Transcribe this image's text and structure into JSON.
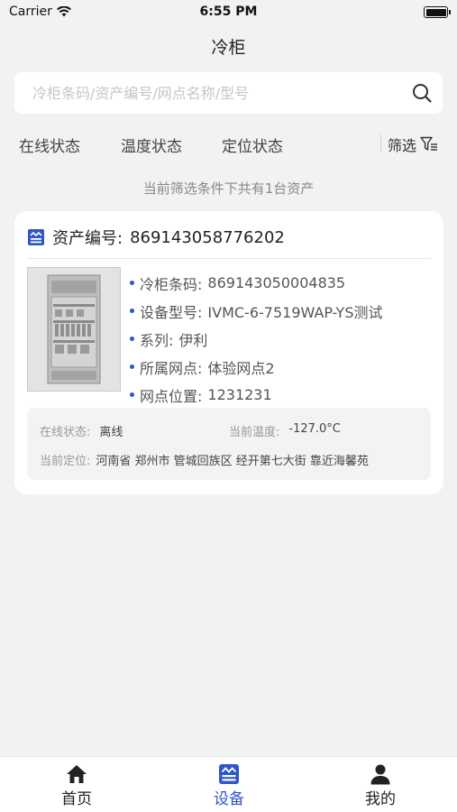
{
  "status_bar": {
    "carrier": "Carrier",
    "time": "6:55 PM"
  },
  "nav": {
    "title": "冷柜"
  },
  "search": {
    "placeholder": "冷柜条码/资产编号/网点名称/型号"
  },
  "filters": {
    "tabs": [
      "在线状态",
      "温度状态",
      "定位状态"
    ],
    "filter_label": "筛选"
  },
  "summary": "当前筛选条件下共有1台资产",
  "asset": {
    "asset_no_label": "资产编号:",
    "asset_no": "869143058776202",
    "fields": [
      {
        "label": "冷柜条码:",
        "value": "869143050004835"
      },
      {
        "label": "设备型号:",
        "value": "IVMC-6-7519WAP-YS测试"
      },
      {
        "label": "系列:",
        "value": "伊利"
      },
      {
        "label": "所属网点:",
        "value": "体验网点2"
      },
      {
        "label": "网点位置:",
        "value": "1231231"
      }
    ],
    "online_label": "在线状态:",
    "online_value": "离线",
    "temp_label": "当前温度:",
    "temp_value": "-127.0°C",
    "location_label": "当前定位:",
    "location_value": "河南省 郑州市 管城回族区 经开第七大街 靠近海馨苑"
  },
  "tabbar": {
    "items": [
      {
        "label": "首页",
        "icon": "home-icon"
      },
      {
        "label": "设备",
        "icon": "device-icon"
      },
      {
        "label": "我的",
        "icon": "user-icon"
      }
    ],
    "active_color": "#2f55c9"
  }
}
